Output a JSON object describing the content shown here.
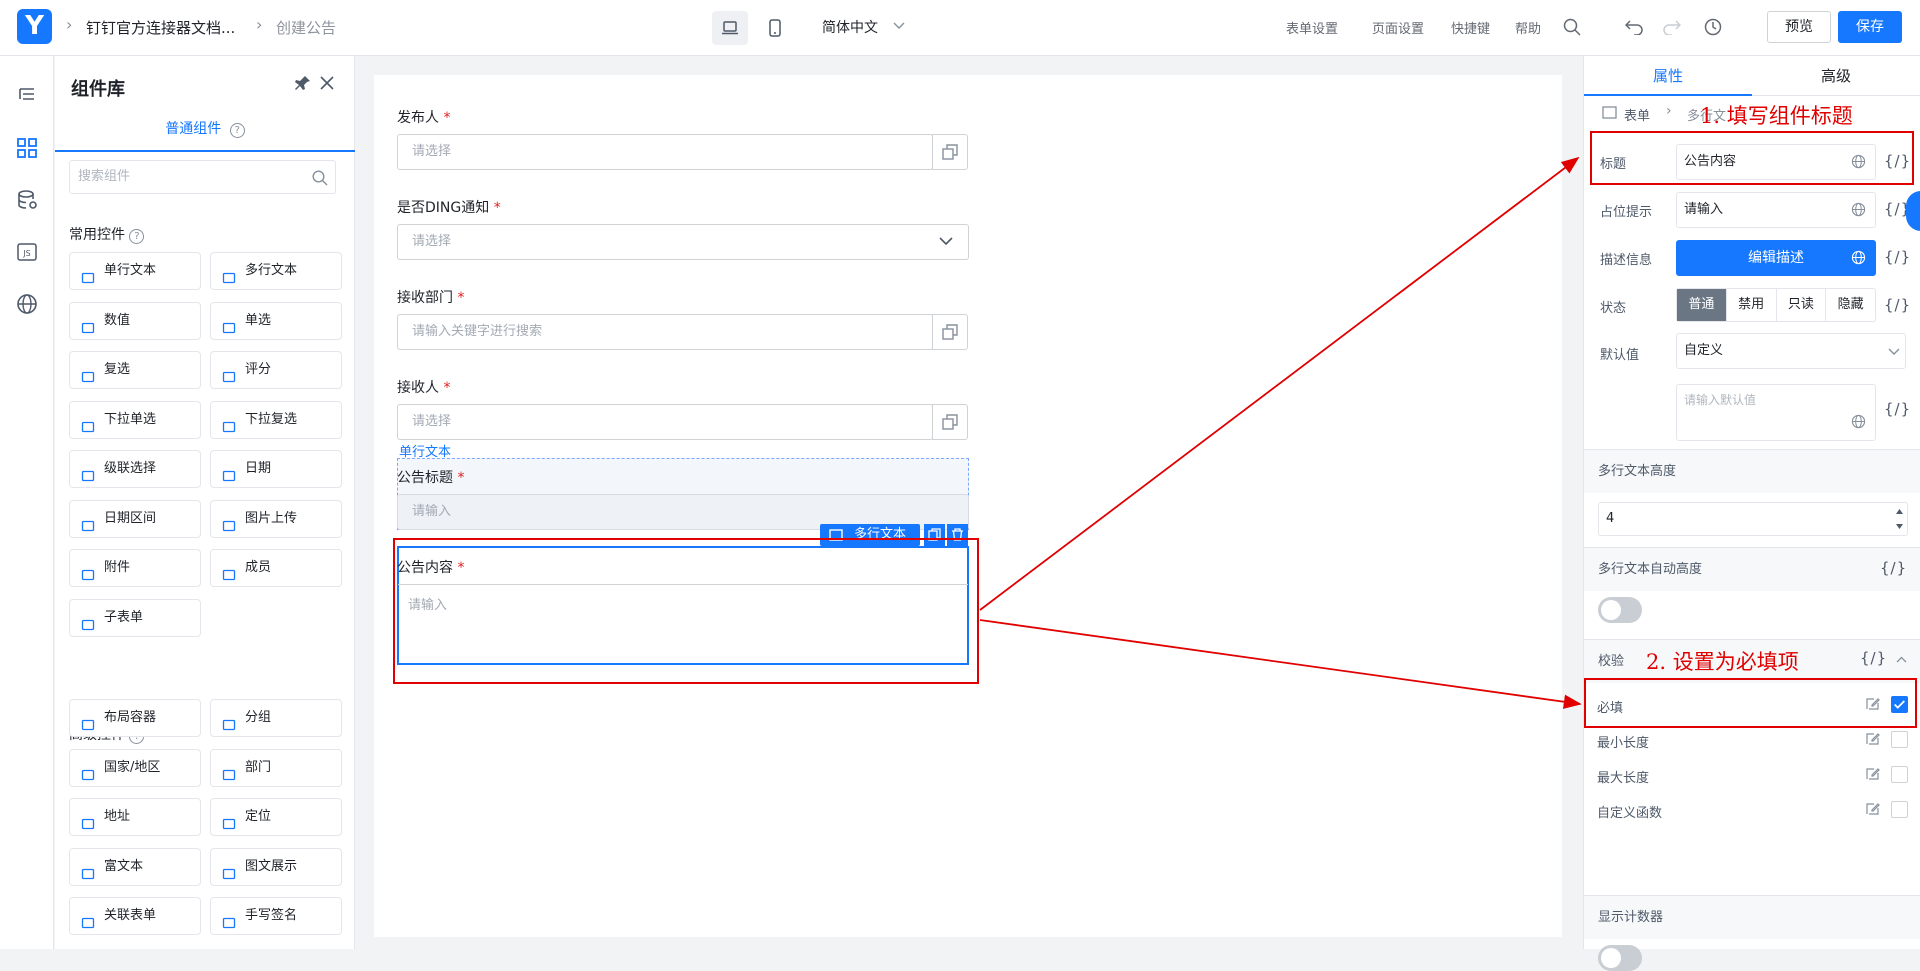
{
  "topbar": {
    "logo": "Y",
    "breadcrumb": [
      "钉钉官方连接器文档...",
      "创建公告"
    ],
    "language": "简体中文",
    "links": [
      "表单设置",
      "页面设置",
      "快捷键",
      "帮助"
    ],
    "preview": "预览",
    "save": "保存"
  },
  "library": {
    "title": "组件库",
    "tab": "普通组件",
    "search_placeholder": "搜索组件",
    "common_title": "常用控件",
    "common": [
      "单行文本",
      "多行文本",
      "数值",
      "单选",
      "复选",
      "评分",
      "下拉单选",
      "下拉复选",
      "级联选择",
      "日期",
      "日期区间",
      "图片上传",
      "附件",
      "成员",
      "子表单"
    ],
    "advanced_title": "高级控件",
    "advanced": [
      "布局容器",
      "分组",
      "国家/地区",
      "部门",
      "地址",
      "定位",
      "富文本",
      "图文展示",
      "关联表单",
      "手写签名"
    ]
  },
  "form": {
    "fields": [
      {
        "label": "发布人",
        "placeholder": "请选择"
      },
      {
        "label": "是否DING通知",
        "placeholder": "请选择"
      },
      {
        "label": "接收部门",
        "placeholder": "请输入关键字进行搜索"
      },
      {
        "label": "接收人",
        "placeholder": "请选择"
      }
    ],
    "hover_tag": "单行文本",
    "title_field": {
      "label": "公告标题",
      "placeholder": "请输入"
    },
    "selected_tag": "多行文本",
    "content_field": {
      "label": "公告内容",
      "placeholder": "请输入"
    },
    "required_mark": "*"
  },
  "props": {
    "tabs": [
      "属性",
      "高级"
    ],
    "crumb": [
      "表单",
      "多行文"
    ],
    "title_label": "标题",
    "title_value": "公告内容",
    "placeholder_label": "占位提示",
    "placeholder_value": "请输入",
    "desc_label": "描述信息",
    "desc_button": "编辑描述",
    "state_label": "状态",
    "states": [
      "普通",
      "禁用",
      "只读",
      "隐藏"
    ],
    "default_label": "默认值",
    "default_mode": "自定义",
    "default_placeholder": "请输入默认值",
    "height_label": "多行文本高度",
    "height_value": "4",
    "auto_height_label": "多行文本自动高度",
    "validation_label": "校验",
    "rules": [
      {
        "label": "必填",
        "checked": true
      },
      {
        "label": "最小长度",
        "checked": false
      },
      {
        "label": "最大长度",
        "checked": false
      },
      {
        "label": "自定义函数",
        "checked": false
      }
    ],
    "counter_label": "显示计数器",
    "fx": "{/}"
  },
  "annotations": [
    "1. 填写组件标题",
    "2. 设置为必填项"
  ],
  "colors": {
    "accent": "#1677ff",
    "annotation": "#e00000"
  }
}
